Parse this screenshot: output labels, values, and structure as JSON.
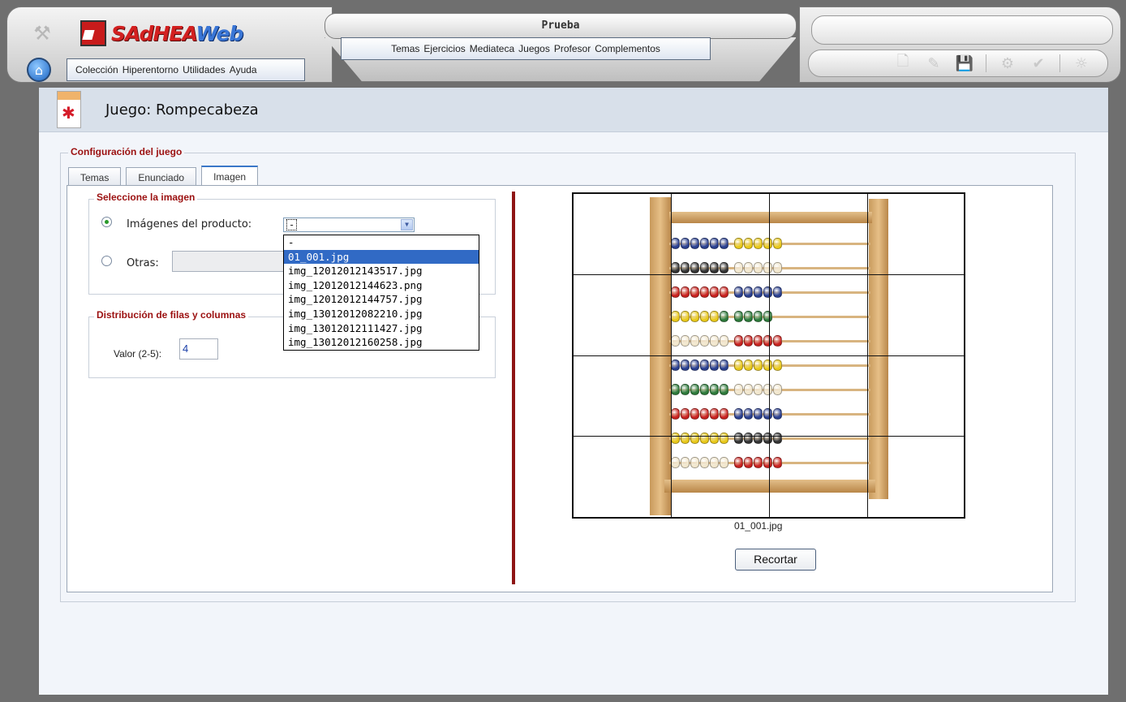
{
  "app": {
    "logo": "SAdHEAWeb",
    "logo_part1": "SAdHEA",
    "logo_part2": "Web",
    "document_title": "Prueba"
  },
  "main_menu": [
    "Colección",
    "Hiperentorno",
    "Utilidades",
    "Ayuda"
  ],
  "center_menu": [
    "Temas",
    "Ejercicios",
    "Mediateca",
    "Juegos",
    "Profesor",
    "Complementos"
  ],
  "toolbar_icons": [
    "new-document-icon",
    "edit-document-icon",
    "save-icon",
    "settings-icon",
    "check-icon",
    "config-panel-icon"
  ],
  "page": {
    "title": "Juego: Rompecabeza"
  },
  "config": {
    "legend": "Configuración del juego",
    "tabs": [
      "Temas",
      "Enunciado",
      "Imagen"
    ],
    "active_tab": "Imagen"
  },
  "image_select": {
    "legend": "Seleccione la imagen",
    "producto_label": "Imágenes del producto:",
    "producto_value": "-",
    "otras_label": "Otras:",
    "options": [
      "-",
      "01_001.jpg",
      "img_12012012143517.jpg",
      "img_12012012144623.png",
      "img_12012012144757.jpg",
      "img_13012012082210.jpg",
      "img_13012012111427.jpg",
      "img_13012012160258.jpg"
    ],
    "highlighted_option": "01_001.jpg"
  },
  "distribution": {
    "legend": "Distribución de filas y columnas",
    "valor_label": "Valor (2-5):",
    "valor_value": "4"
  },
  "preview": {
    "caption": "01_001.jpg",
    "grid": 4,
    "button_label": "Recortar"
  },
  "colors": {
    "accent_red": "#9b1010",
    "divider": "#8e1414",
    "selection_blue": "#316ac5"
  }
}
